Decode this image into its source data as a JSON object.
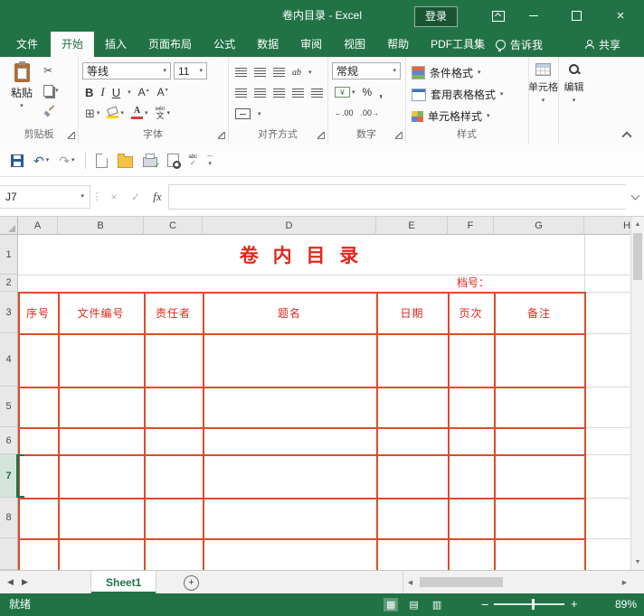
{
  "titlebar": {
    "title": "卷内目录 - Excel",
    "signin": "登录"
  },
  "tabs": [
    "文件",
    "开始",
    "插入",
    "页面布局",
    "公式",
    "数据",
    "审阅",
    "视图",
    "帮助",
    "PDF工具集"
  ],
  "tab_extras": {
    "tellme": "告诉我",
    "share": "共享"
  },
  "ribbon": {
    "clipboard": {
      "label": "剪贴板",
      "paste": "粘贴"
    },
    "font": {
      "label": "字体",
      "name": "等线",
      "size": "11",
      "bold": "B",
      "italic": "I",
      "underline": "U",
      "grow": "A",
      "shrink": "A",
      "phonetic_top": "wén",
      "phonetic_bottom": "文"
    },
    "alignment": {
      "label": "对齐方式",
      "wrap": "ab"
    },
    "number": {
      "label": "数字",
      "format": "常规",
      "currency": "¥",
      "percent": "%",
      "comma": ",",
      "inc_decimal": ".00",
      "dec_decimal": ".00"
    },
    "styles": {
      "label": "样式",
      "conditional": "条件格式",
      "format_table": "套用表格格式",
      "cell_styles": "单元格样式"
    },
    "cells": {
      "label": "单元格"
    },
    "editing": {
      "label": "编辑"
    }
  },
  "formula_bar": {
    "name_box": "J7",
    "fx": "fx",
    "value": ""
  },
  "sheet": {
    "col_headers": [
      "A",
      "B",
      "C",
      "D",
      "E",
      "F",
      "G",
      "H"
    ],
    "row_headers": [
      "1",
      "2",
      "3",
      "4",
      "5",
      "6",
      "7",
      "8"
    ],
    "doc_title": "卷 内 目 录",
    "file_no": "档号：",
    "table_headers": [
      "序号",
      "文件编号",
      "责任者",
      "题名",
      "日期",
      "页次",
      "备注"
    ]
  },
  "sheet_tabs": {
    "active": "Sheet1"
  },
  "statusbar": {
    "mode": "就绪",
    "zoom": "89%"
  },
  "colors": {
    "excel_green": "#217346",
    "table_border": "#dd4b2a",
    "cell_text_red": "#e0281a"
  }
}
